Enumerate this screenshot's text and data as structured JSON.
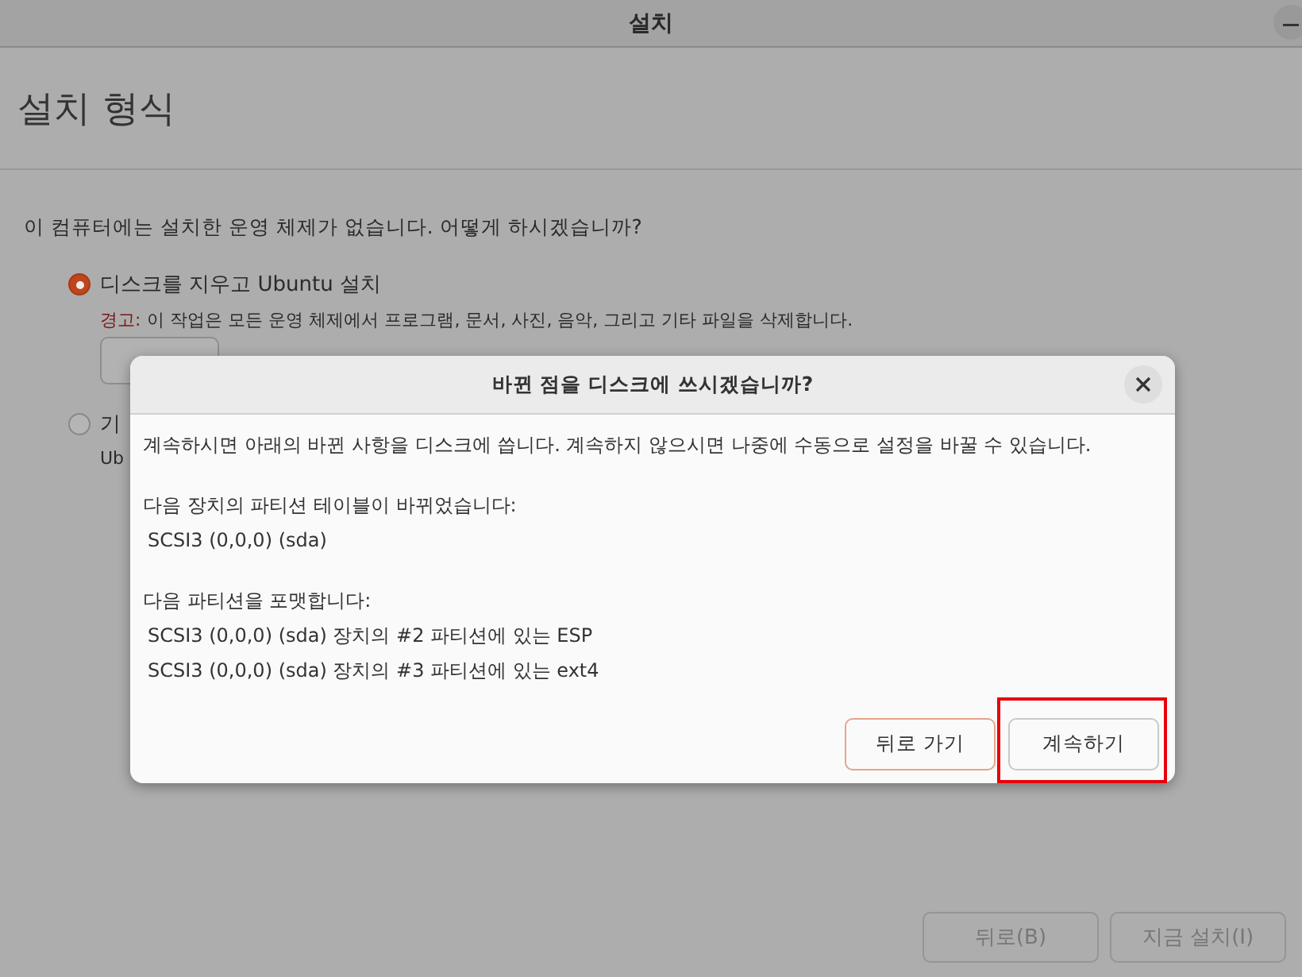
{
  "window": {
    "title": "설치"
  },
  "page": {
    "heading": "설치 형식",
    "question": "이 컴퓨터에는 설치한 운영 체제가 없습니다. 어떻게 하시겠습니까?"
  },
  "options": [
    {
      "label": "디스크를 지우고 Ubuntu 설치",
      "selected": true,
      "warning_label": "경고:",
      "warning_text": "이 작업은 모든 운영 체제에서 프로그램, 문서, 사진, 음악, 그리고 기타 파일을 삭제합니다.",
      "advanced_button": true
    },
    {
      "label": "기",
      "selected": false,
      "description": "Ub"
    }
  ],
  "footer_buttons": [
    {
      "label": "뒤로(B)",
      "disabled": true
    },
    {
      "label": "지금 설치(I)",
      "disabled": true
    }
  ],
  "dialog": {
    "title": "바뀐 점을 디스크에 쓰시겠습니까?",
    "intro": "계속하시면 아래의 바뀐 사항을 디스크에 씁니다. 계속하지 않으시면 나중에 수동으로 설정을 바꿀 수 있습니다.",
    "sections": [
      {
        "heading": "다음 장치의 파티션 테이블이 바뀌었습니다:",
        "items": [
          "SCSI3 (0,0,0) (sda)"
        ]
      },
      {
        "heading": "다음 파티션을 포맷합니다:",
        "items": [
          "SCSI3 (0,0,0) (sda) 장치의 #2 파티션에 있는 ESP",
          "SCSI3 (0,0,0) (sda) 장치의 #3 파티션에 있는 ext4"
        ]
      }
    ],
    "buttons": [
      {
        "label": "뒤로 가기",
        "kind": "back"
      },
      {
        "label": "계속하기",
        "kind": "continue",
        "highlighted": true
      }
    ]
  }
}
